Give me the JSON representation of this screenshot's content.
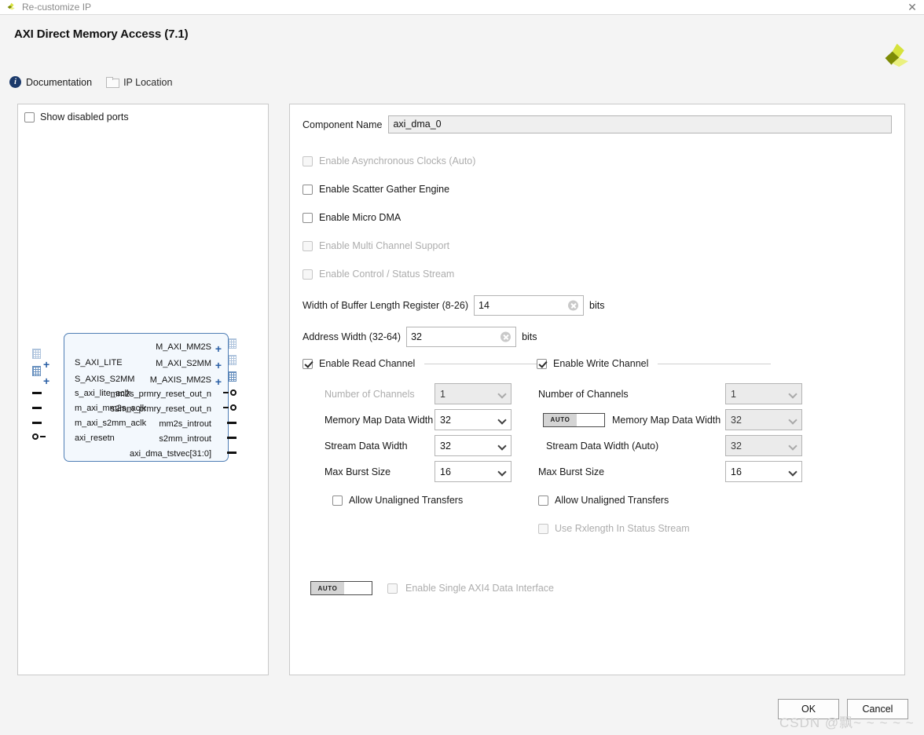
{
  "window": {
    "title": "Re-customize IP",
    "close_label": "✕",
    "logo_icon": "xilinx-logo"
  },
  "header": {
    "ip_title": "AXI Direct Memory Access (7.1)",
    "links": [
      {
        "label": "Documentation",
        "icon": "info-icon",
        "enabled": true
      },
      {
        "label": "IP Location",
        "icon": "folder-icon",
        "enabled": false
      }
    ]
  },
  "left_panel": {
    "show_disabled_ports": {
      "label": "Show disabled ports",
      "checked": false
    },
    "block": {
      "left_ports": [
        {
          "label": "S_AXI_LITE",
          "type": "bus"
        },
        {
          "label": "S_AXIS_S2MM",
          "type": "bus"
        },
        {
          "label": "s_axi_lite_aclk",
          "type": "clk"
        },
        {
          "label": "m_axi_mm2s_aclk",
          "type": "clk"
        },
        {
          "label": "m_axi_s2mm_aclk",
          "type": "clk"
        },
        {
          "label": "axi_resetn",
          "type": "reset"
        }
      ],
      "right_ports": [
        {
          "label": "M_AXI_MM2S",
          "type": "bus"
        },
        {
          "label": "M_AXI_S2MM",
          "type": "bus"
        },
        {
          "label": "M_AXIS_MM2S",
          "type": "bus"
        },
        {
          "label": "mm2s_prmry_reset_out_n",
          "type": "reset"
        },
        {
          "label": "s2mm_prmry_reset_out_n",
          "type": "reset"
        },
        {
          "label": "mm2s_introut",
          "type": "sig"
        },
        {
          "label": "s2mm_introut",
          "type": "sig"
        },
        {
          "label": "axi_dma_tstvec[31:0]",
          "type": "sig"
        }
      ]
    }
  },
  "right_panel": {
    "component_name": {
      "label": "Component Name",
      "value": "axi_dma_0"
    },
    "options": [
      {
        "label": "Enable Asynchronous Clocks (Auto)",
        "checked": false,
        "enabled": false
      },
      {
        "label": "Enable Scatter Gather Engine",
        "checked": false,
        "enabled": true
      },
      {
        "label": "Enable Micro DMA",
        "checked": false,
        "enabled": true
      },
      {
        "label": "Enable Multi Channel Support",
        "checked": false,
        "enabled": false
      },
      {
        "label": "Enable Control / Status Stream",
        "checked": false,
        "enabled": false
      }
    ],
    "numeric_fields": [
      {
        "label": "Width of Buffer Length Register (8-26)",
        "value": "14",
        "unit": "bits",
        "width": 140
      },
      {
        "label": "Address Width (32-64)",
        "value": "32",
        "unit": "bits",
        "width": 140
      }
    ],
    "read_channel": {
      "enable_label": "Enable Read Channel",
      "enabled": true,
      "rows": [
        {
          "label": "Number of Channels",
          "value": "1",
          "enabled": false
        },
        {
          "label": "Memory Map Data Width",
          "value": "32",
          "enabled": true
        },
        {
          "label": "Stream Data Width",
          "value": "32",
          "enabled": true
        },
        {
          "label": "Max Burst Size",
          "value": "16",
          "enabled": true
        }
      ],
      "allow_unaligned": {
        "label": "Allow Unaligned Transfers",
        "checked": false,
        "enabled": true
      }
    },
    "write_channel": {
      "enable_label": "Enable Write Channel",
      "enabled": true,
      "rows": [
        {
          "label": "Number of Channels",
          "value": "1",
          "enabled": false,
          "auto_toggle": false
        },
        {
          "label": "Memory Map Data Width",
          "value": "32",
          "enabled": false,
          "auto_toggle": true,
          "auto_label": "AUTO"
        },
        {
          "label": "Stream Data Width (Auto)",
          "value": "32",
          "enabled": false,
          "auto_toggle": false
        },
        {
          "label": "Max Burst Size",
          "value": "16",
          "enabled": true,
          "auto_toggle": false
        }
      ],
      "allow_unaligned": {
        "label": "Allow Unaligned Transfers",
        "checked": false,
        "enabled": true
      },
      "use_rxlength": {
        "label": "Use Rxlength In Status Stream",
        "checked": false,
        "enabled": false
      }
    },
    "single_axi": {
      "auto_label": "AUTO",
      "label": "Enable Single AXI4 Data Interface",
      "checked": false,
      "enabled": false
    }
  },
  "footer": {
    "ok_label": "OK",
    "cancel_label": "Cancel"
  },
  "watermark": "CSDN @飘~ ~ ~ ~ ~"
}
